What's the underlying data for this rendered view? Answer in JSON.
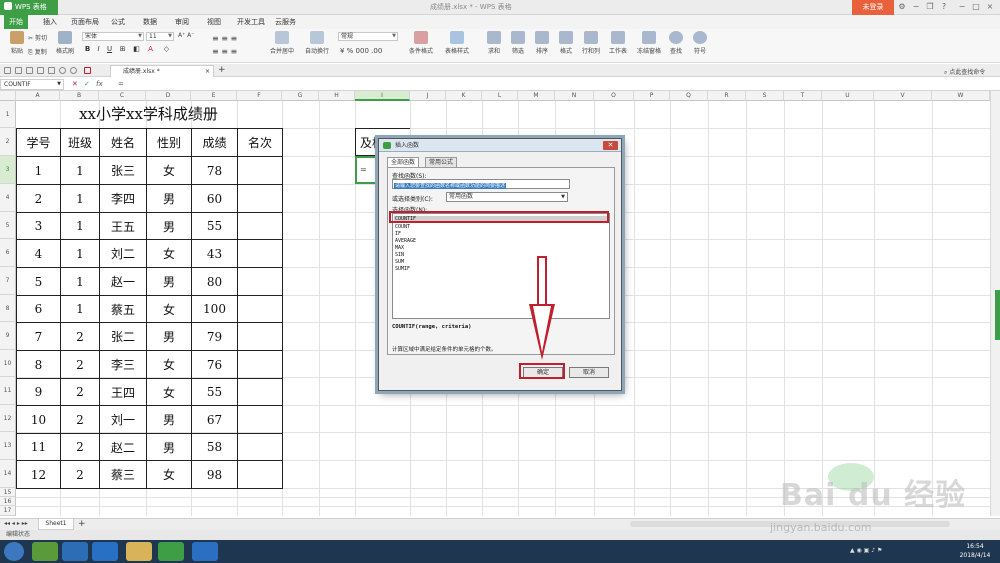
{
  "app": {
    "name": "WPS 表格",
    "doc_title": "成绩册.xlsx * - WPS 表格",
    "login": "未登录"
  },
  "menu": [
    "开始",
    "插入",
    "页面布局",
    "公式",
    "数据",
    "审阅",
    "视图",
    "开发工具",
    "云服务"
  ],
  "ribbon": {
    "paste": "粘贴",
    "cut": "剪切",
    "copy": "复制",
    "format_painter": "格式刷",
    "font_name": "宋体",
    "font_size": "11",
    "merge_center": "合并居中",
    "wrap_text": "自动换行",
    "number_format": "常规",
    "cond_format": "条件格式",
    "table_style": "表格样式",
    "sum": "求和",
    "filter": "筛选",
    "sort": "排序",
    "format": "格式",
    "row_col": "行和列",
    "worksheet": "工作表",
    "freeze": "冻结窗格",
    "find": "查找",
    "symbol": "符号",
    "hint": "点此查找命令"
  },
  "doc_tab": "成绩册.xlsx *",
  "formula_bar": {
    "name_box": "COUNTIF",
    "content": "="
  },
  "columns": [
    "A",
    "B",
    "C",
    "D",
    "E",
    "F",
    "G",
    "H",
    "I",
    "J",
    "K",
    "L",
    "M",
    "N",
    "O",
    "P",
    "Q",
    "R",
    "S",
    "T",
    "U",
    "V",
    "W"
  ],
  "rows": [
    "1",
    "2",
    "3",
    "4",
    "5",
    "6",
    "7",
    "8",
    "9",
    "10",
    "11",
    "12",
    "13",
    "14",
    "15",
    "16",
    "17"
  ],
  "sheet": {
    "title": "xx小学xx学科成绩册",
    "headers": [
      "学号",
      "班级",
      "姓名",
      "性别",
      "成绩",
      "名次"
    ],
    "data": [
      [
        "1",
        "1",
        "张三",
        "女",
        "78",
        ""
      ],
      [
        "2",
        "1",
        "李四",
        "男",
        "60",
        ""
      ],
      [
        "3",
        "1",
        "王五",
        "男",
        "55",
        ""
      ],
      [
        "4",
        "1",
        "刘二",
        "女",
        "43",
        ""
      ],
      [
        "5",
        "1",
        "赵一",
        "男",
        "80",
        ""
      ],
      [
        "6",
        "1",
        "蔡五",
        "女",
        "100",
        ""
      ],
      [
        "7",
        "2",
        "张二",
        "男",
        "79",
        ""
      ],
      [
        "8",
        "2",
        "李三",
        "女",
        "76",
        ""
      ],
      [
        "9",
        "2",
        "王四",
        "女",
        "55",
        ""
      ],
      [
        "10",
        "2",
        "刘一",
        "男",
        "67",
        ""
      ],
      [
        "11",
        "2",
        "赵二",
        "男",
        "58",
        ""
      ],
      [
        "12",
        "2",
        "蔡三",
        "女",
        "98",
        ""
      ]
    ],
    "partial_header": "及格",
    "active_cell_value": "="
  },
  "dialog": {
    "title": "插入函数",
    "tabs": [
      "全部函数",
      "常用公式"
    ],
    "search_label": "查找函数(S):",
    "search_value": "请输入您要查找的函数名称或函数功能的简要描述",
    "category_label": "或选择类别(C):",
    "category_value": "常用函数",
    "list_label": "选择函数(N):",
    "functions": [
      "COUNTIF",
      "COUNT",
      "IF",
      "AVERAGE",
      "MAX",
      "SIN",
      "SUM",
      "SUMIF"
    ],
    "selected": "COUNTIF",
    "syntax": "COUNTIF(range, criteria)",
    "description": "计算区域中满足给定条件的单元格的个数。",
    "ok": "确定",
    "cancel": "取消"
  },
  "sheet_tab": "Sheet1",
  "status": "编辑状态",
  "clock": {
    "time": "16:54",
    "date": "2018/4/14"
  },
  "watermark": {
    "brand": "Bai du 经验",
    "url": "jingyan.baidu.com"
  },
  "colors": {
    "accent": "#3d9e46",
    "highlight": "#c0202e",
    "taskbar": "#1e3650"
  }
}
